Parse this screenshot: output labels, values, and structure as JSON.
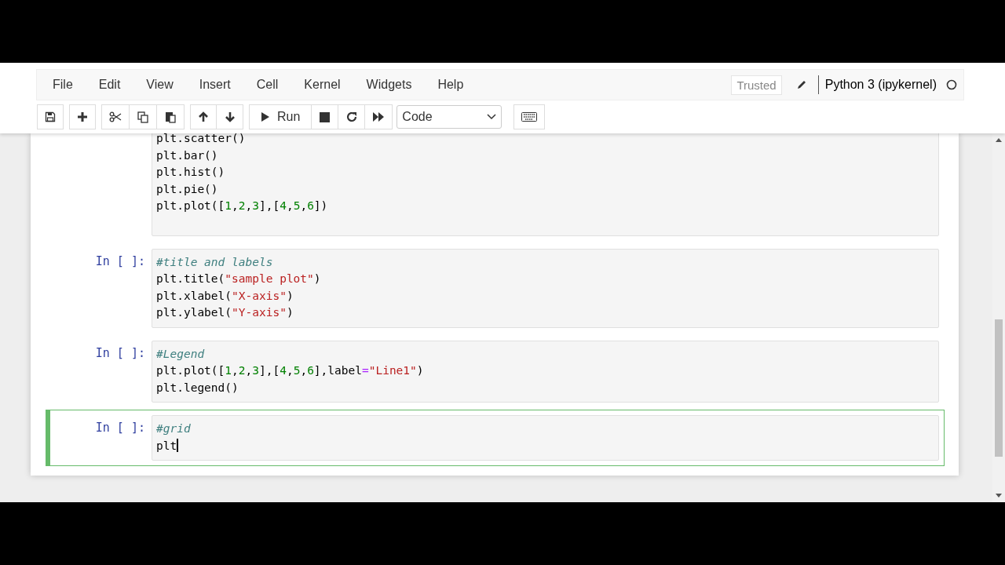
{
  "menu": [
    "File",
    "Edit",
    "View",
    "Insert",
    "Cell",
    "Kernel",
    "Widgets",
    "Help"
  ],
  "trusted": "Trusted",
  "kernel_name": "Python 3 (ipykernel)",
  "toolbar": {
    "run_label": "Run",
    "cell_type": "Code"
  },
  "cells": [
    {
      "selected": false,
      "lines": [
        [
          {
            "t": "plt.scatter()",
            "kind": "plain"
          }
        ],
        [
          {
            "t": "plt.bar()",
            "kind": "plain"
          }
        ],
        [
          {
            "t": "plt.hist()",
            "kind": "plain"
          }
        ],
        [
          {
            "t": "plt.pie()",
            "kind": "plain"
          }
        ],
        [
          {
            "t": "plt.plot([",
            "kind": "plain"
          },
          {
            "t": "1",
            "kind": "num"
          },
          {
            "t": ",",
            "kind": "plain"
          },
          {
            "t": "2",
            "kind": "num"
          },
          {
            "t": ",",
            "kind": "plain"
          },
          {
            "t": "3",
            "kind": "num"
          },
          {
            "t": "],[",
            "kind": "plain"
          },
          {
            "t": "4",
            "kind": "num"
          },
          {
            "t": ",",
            "kind": "plain"
          },
          {
            "t": "5",
            "kind": "num"
          },
          {
            "t": ",",
            "kind": "plain"
          },
          {
            "t": "6",
            "kind": "num"
          },
          {
            "t": "])",
            "kind": "plain"
          }
        ]
      ]
    },
    {
      "prompt": "In [ ]:",
      "selected": false,
      "lines": [
        [
          {
            "t": "#title and labels",
            "kind": "comment"
          }
        ],
        [
          {
            "t": "plt.title(",
            "kind": "plain"
          },
          {
            "t": "\"sample plot\"",
            "kind": "str"
          },
          {
            "t": ")",
            "kind": "plain"
          }
        ],
        [
          {
            "t": "plt.xlabel(",
            "kind": "plain"
          },
          {
            "t": "\"X-axis\"",
            "kind": "str"
          },
          {
            "t": ")",
            "kind": "plain"
          }
        ],
        [
          {
            "t": "plt.ylabel(",
            "kind": "plain"
          },
          {
            "t": "\"Y-axis\"",
            "kind": "str"
          },
          {
            "t": ")",
            "kind": "plain"
          }
        ]
      ]
    },
    {
      "prompt": "In [ ]:",
      "selected": false,
      "lines": [
        [
          {
            "t": "#Legend",
            "kind": "comment"
          }
        ],
        [
          {
            "t": "plt.plot([",
            "kind": "plain"
          },
          {
            "t": "1",
            "kind": "num"
          },
          {
            "t": ",",
            "kind": "plain"
          },
          {
            "t": "2",
            "kind": "num"
          },
          {
            "t": ",",
            "kind": "plain"
          },
          {
            "t": "3",
            "kind": "num"
          },
          {
            "t": "],[",
            "kind": "plain"
          },
          {
            "t": "4",
            "kind": "num"
          },
          {
            "t": ",",
            "kind": "plain"
          },
          {
            "t": "5",
            "kind": "num"
          },
          {
            "t": ",",
            "kind": "plain"
          },
          {
            "t": "6",
            "kind": "num"
          },
          {
            "t": "],label",
            "kind": "plain"
          },
          {
            "t": "=",
            "kind": "op"
          },
          {
            "t": "\"Line1\"",
            "kind": "str"
          },
          {
            "t": ")",
            "kind": "plain"
          }
        ],
        [
          {
            "t": "plt.legend()",
            "kind": "plain"
          }
        ]
      ]
    },
    {
      "prompt": "In [ ]:",
      "selected": true,
      "lines": [
        [
          {
            "t": "#grid",
            "kind": "comment"
          }
        ],
        [
          {
            "t": "plt",
            "kind": "plain"
          }
        ]
      ]
    }
  ]
}
